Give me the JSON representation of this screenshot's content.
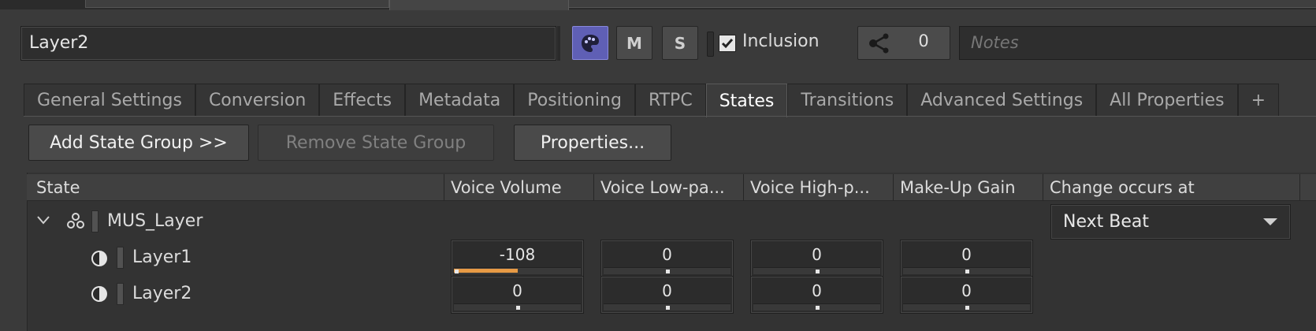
{
  "layer": {
    "name": "Layer2"
  },
  "header": {
    "m_label": "M",
    "s_label": "S",
    "inclusion_label": "Inclusion",
    "share_count": "0",
    "notes_placeholder": "Notes"
  },
  "tabs": [
    {
      "label": "General Settings"
    },
    {
      "label": "Conversion"
    },
    {
      "label": "Effects"
    },
    {
      "label": "Metadata"
    },
    {
      "label": "Positioning"
    },
    {
      "label": "RTPC"
    },
    {
      "label": "States"
    },
    {
      "label": "Transitions"
    },
    {
      "label": "Advanced Settings"
    },
    {
      "label": "All Properties"
    },
    {
      "label": "+"
    }
  ],
  "active_tab": "States",
  "actions": {
    "add": "Add State Group >>",
    "remove": "Remove State Group",
    "properties": "Properties..."
  },
  "table": {
    "columns": [
      "State",
      "Voice Volume",
      "Voice Low-pa...",
      "Voice High-p...",
      "Make-Up Gain",
      "Change occurs at"
    ],
    "group": {
      "name": "MUS_Layer",
      "change_occurs_at": "Next Beat"
    },
    "rows": [
      {
        "name": "Layer1",
        "values": [
          "-108",
          "0",
          "0",
          "0"
        ],
        "volume_fill_fraction": 0.5
      },
      {
        "name": "Layer2",
        "values": [
          "0",
          "0",
          "0",
          "0"
        ]
      }
    ]
  },
  "colors": {
    "accent_palette": "#5f5fb5",
    "slider_fill": "#e79a45"
  },
  "icons": [
    "palette-icon",
    "checkbox-checked-icon",
    "share-icon",
    "chevron-down-icon",
    "state-group-icon",
    "state-icon",
    "dropdown-arrow-icon"
  ]
}
